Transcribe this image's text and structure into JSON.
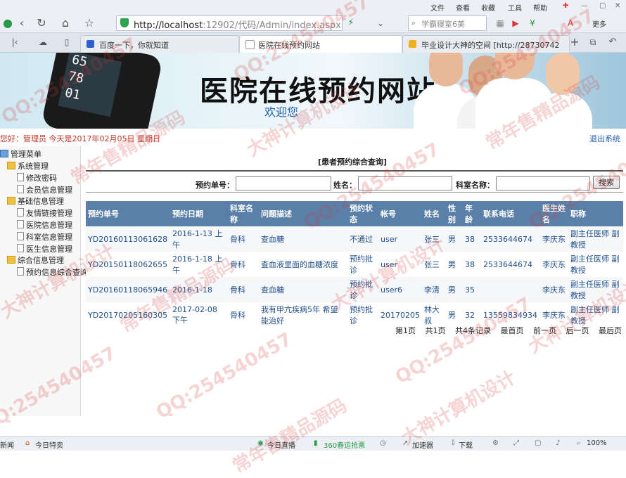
{
  "browser": {
    "menu": [
      "文件",
      "查看",
      "收藏",
      "工具",
      "帮助"
    ],
    "more_label": "更多",
    "url_host": "http://localhost",
    "url_path": ":12902/代码/Admin/index.aspx",
    "search_placeholder": "学霸寝室6美",
    "tabs": [
      {
        "title": "百度一下，你就知道"
      },
      {
        "title": "医院在线预约网站"
      },
      {
        "title": "毕业设计大神的空间 [http://28730742"
      }
    ]
  },
  "banner": {
    "title": "医院在线预约网站",
    "subtitle": "欢迎您"
  },
  "userbar": {
    "welcome": "您好：管理员   今天是2017年02月05日   星期日",
    "logout": "退出系统"
  },
  "sidebar": {
    "root": "管理菜单",
    "groups": [
      {
        "label": "系统管理",
        "items": [
          "修改密码",
          "会员信息管理"
        ]
      },
      {
        "label": "基础信息管理",
        "items": [
          "友情链接管理",
          "医院信息管理",
          "科室信息管理",
          "医生信息管理"
        ]
      },
      {
        "label": "综合信息管理",
        "items": [
          "预约信息综合查询"
        ]
      }
    ]
  },
  "main": {
    "section_title": "[患者预约综合查询]",
    "filters": {
      "order_no_label": "预约单号：",
      "name_label": "姓名：",
      "dept_label": "科室名称：",
      "search_button": "搜索"
    },
    "table": {
      "headers": [
        "预约单号",
        "预约日期",
        "科室名称",
        "问题描述",
        "预约状态",
        "帐号",
        "姓名",
        "性别",
        "年龄",
        "联系电话",
        "医生姓名",
        "职称"
      ],
      "rows": [
        [
          "YD20160113061628",
          "2016-1-13 上午",
          "骨科",
          "查血糖",
          "不通过",
          "user",
          "张三",
          "男",
          "38",
          "2533644674",
          "李庆东",
          "副主任医师 副教授"
        ],
        [
          "YD20150118062655",
          "2016-1-18 上午",
          "骨科",
          "查血液里面的血糖浓度",
          "预约批诊",
          "user",
          "张三",
          "男",
          "38",
          "2533644674",
          "李庆东",
          "副主任医师 副教授"
        ],
        [
          "YD20160118065946",
          "2016-1-18",
          "骨科",
          "查血糖",
          "预约批诊",
          "user6",
          "李清",
          "男",
          "35",
          "",
          "李庆东",
          "副主任医师 副教授"
        ],
        [
          "YD20170205160305",
          "2017-02-08 下午",
          "骨科",
          "我有甲亢疾病5年 希望能治好",
          "预约批诊",
          "20170205",
          "林大叔",
          "男",
          "32",
          "13559834934",
          "李庆东",
          "副主任医师 副教授"
        ]
      ]
    },
    "pager": {
      "current": "第1页",
      "total_pages": "共1页",
      "total_records": "共4条记录",
      "first": "最首页",
      "prev": "前一页",
      "next": "后一页",
      "last": "最后页"
    }
  },
  "statusbar": {
    "items": [
      "新闻",
      "今日特卖",
      "今日直播",
      "360春运抢票",
      "加速器",
      "下载",
      "100%"
    ]
  },
  "watermarks": [
    "QQ:254540457",
    "常年售精品源码",
    "大神计算机设计"
  ]
}
